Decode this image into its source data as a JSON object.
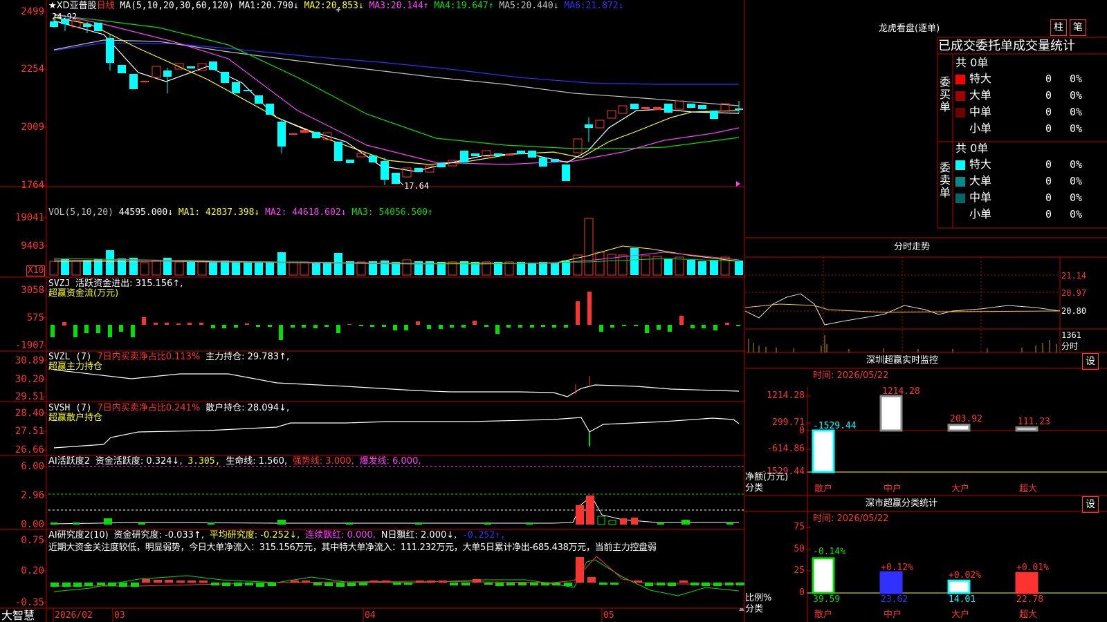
{
  "stock": {
    "name": "★XD亚普股",
    "period": "日线",
    "ma_def": "MA(5,10,20,30,60,120)"
  },
  "price_legend": [
    {
      "label": "MA1:",
      "value": "20.790↓",
      "color": "#ffffff"
    },
    {
      "label": "MA2:",
      "value": "20.853↓",
      "color": "#ffff00"
    },
    {
      "label": "MA3:",
      "value": "20.144↑",
      "color": "#ff40ff"
    },
    {
      "label": "MA4:",
      "value": "19.647↑",
      "color": "#00e000"
    },
    {
      "label": "MA5:",
      "value": "20.440↓",
      "color": "#c0c0c0"
    },
    {
      "label": "MA6:",
      "value": "21.872↓",
      "color": "#3030ff"
    }
  ],
  "price_axis": [
    "2499",
    "2254",
    "2009",
    "1764"
  ],
  "price_annotations": {
    "high": "24.92",
    "low": "17.64"
  },
  "vol": {
    "def": "VOL(5,10,20)",
    "value": "44595.000↓",
    "ma1": "MA1: 42837.398↓",
    "ma2": "MA2: 44618.602↓",
    "ma3": "MA3: 54056.500↑",
    "axis": [
      "19041",
      "9403"
    ],
    "unit": "X10"
  },
  "svzj": {
    "title": "SVZJ",
    "desc": "活跃资金进出: 315.156↑,",
    "sub": "超赢资金流(万元)",
    "axis": [
      "3058",
      "575",
      "-1907"
    ]
  },
  "svzl": {
    "title": "SVZL (7)",
    "desc": "7日内买卖净占比0.113%",
    "hold": "主力持仓: 29.783↑,",
    "sub": "超赢主力持仓",
    "axis": [
      "30.89",
      "30.20",
      "29.51"
    ]
  },
  "svsh": {
    "title": "SVSH (7)",
    "desc": "7日内买卖净占比0.241%",
    "hold": "散户持仓: 28.094↓,",
    "sub": "超赢散户持仓",
    "axis": [
      "28.40",
      "27.51",
      "26.66"
    ]
  },
  "ai1": {
    "title": "AI活跃度2",
    "a": "资金活跃度: 0.324↓,",
    "b": "3.305,",
    "c": "生命线: 1.560,",
    "d": "强势线: 3.000,",
    "e": "爆发线: 6.000,",
    "axis": [
      "6.00",
      "2.96",
      "0.00"
    ]
  },
  "ai2": {
    "title": "AI研究度2(10)",
    "a": "资金研究度: -0.033↑,",
    "b": "平均研究度: -0.252↓,",
    "c": "连续飘红: 0.000,",
    "d": "N日飘红: 2.000↓,",
    "e": "-0.252↑,",
    "text": "近期大资金关注度较低，明显弱势，今日大单净流入：315.156万元，其中特大单净流入：111.232万元，大单5日累计净出-685.438万元，当前主力控盘弱",
    "axis": [
      "0.75",
      "0.20",
      "-0.35"
    ]
  },
  "dates": {
    "brand": "大智慧",
    "d1": "2026/02",
    "d2": "03",
    "d3": "04",
    "d4": "05"
  },
  "lhb": {
    "title": "龙虎看盘(逐单)",
    "btn1": "柱",
    "btn2": "笔",
    "heading": "已成交委托单成交量统计",
    "buy": {
      "label": "委买单",
      "total": "共 0单",
      "rows": [
        {
          "name": "特大",
          "n": "0",
          "p": "0%",
          "color": "#ff0000"
        },
        {
          "name": "大单",
          "n": "0",
          "p": "0%",
          "color": "#a00000"
        },
        {
          "name": "中单",
          "n": "0",
          "p": "0%",
          "color": "#700000"
        },
        {
          "name": "小单",
          "n": "0",
          "p": "0%",
          "color": ""
        }
      ]
    },
    "sell": {
      "label": "委卖单",
      "total": "共 0单",
      "rows": [
        {
          "name": "特大",
          "n": "0",
          "p": "0%",
          "color": "#00ffff"
        },
        {
          "name": "大单",
          "n": "0",
          "p": "0%",
          "color": "#008c8c"
        },
        {
          "name": "中单",
          "n": "0",
          "p": "0%",
          "color": "#006666"
        },
        {
          "name": "小单",
          "n": "0",
          "p": "0%",
          "color": ""
        }
      ]
    }
  },
  "fenshi": {
    "title": "分时走势",
    "axis": [
      "21.14",
      "20.97",
      "20.80",
      "1361"
    ],
    "unit": "分时"
  },
  "monitor": {
    "title": "深圳超赢实时监控",
    "btn": "设",
    "time": "时间: 2026/05/22",
    "axis": [
      "1214.28",
      "299.71",
      "0",
      "-614.86",
      "-1529.44"
    ],
    "ylabel": "净额(万元)",
    "xlabel": "分类",
    "cats": [
      "散户",
      "中户",
      "大户",
      "超大"
    ],
    "labels": [
      "-1529.44",
      "1214.28",
      "203.92",
      "111.23"
    ]
  },
  "classify": {
    "title": "深市超赢分类统计",
    "btn": "设",
    "time": "时间: 2026/05/22",
    "axis": [
      "75",
      "50",
      "25",
      "0"
    ],
    "ylabel": "比例%",
    "xlabel": "分类",
    "cats": [
      "散户",
      "中户",
      "大户",
      "超大"
    ],
    "top": [
      "-0.14%",
      "+0.12%",
      "+0.02%",
      "+0.01%"
    ],
    "bottom": [
      "39.59",
      "23.62",
      "14.01",
      "22.78"
    ]
  },
  "chart_data": [
    {
      "type": "bar",
      "title": "深圳超赢实时监控",
      "categories": [
        "散户",
        "中户",
        "大户",
        "超大"
      ],
      "values": [
        -1529.44,
        1214.28,
        203.92,
        111.23
      ],
      "ylabel": "净额(万元)",
      "xlabel": "分类",
      "ylim": [
        -1529.44,
        1214.28
      ]
    },
    {
      "type": "bar",
      "title": "深市超赢分类统计",
      "categories": [
        "散户",
        "中户",
        "大户",
        "超大"
      ],
      "values": [
        39.59,
        23.62,
        14.01,
        22.78
      ],
      "ylabel": "比例%",
      "xlabel": "分类",
      "ylim": [
        0,
        75
      ]
    }
  ]
}
